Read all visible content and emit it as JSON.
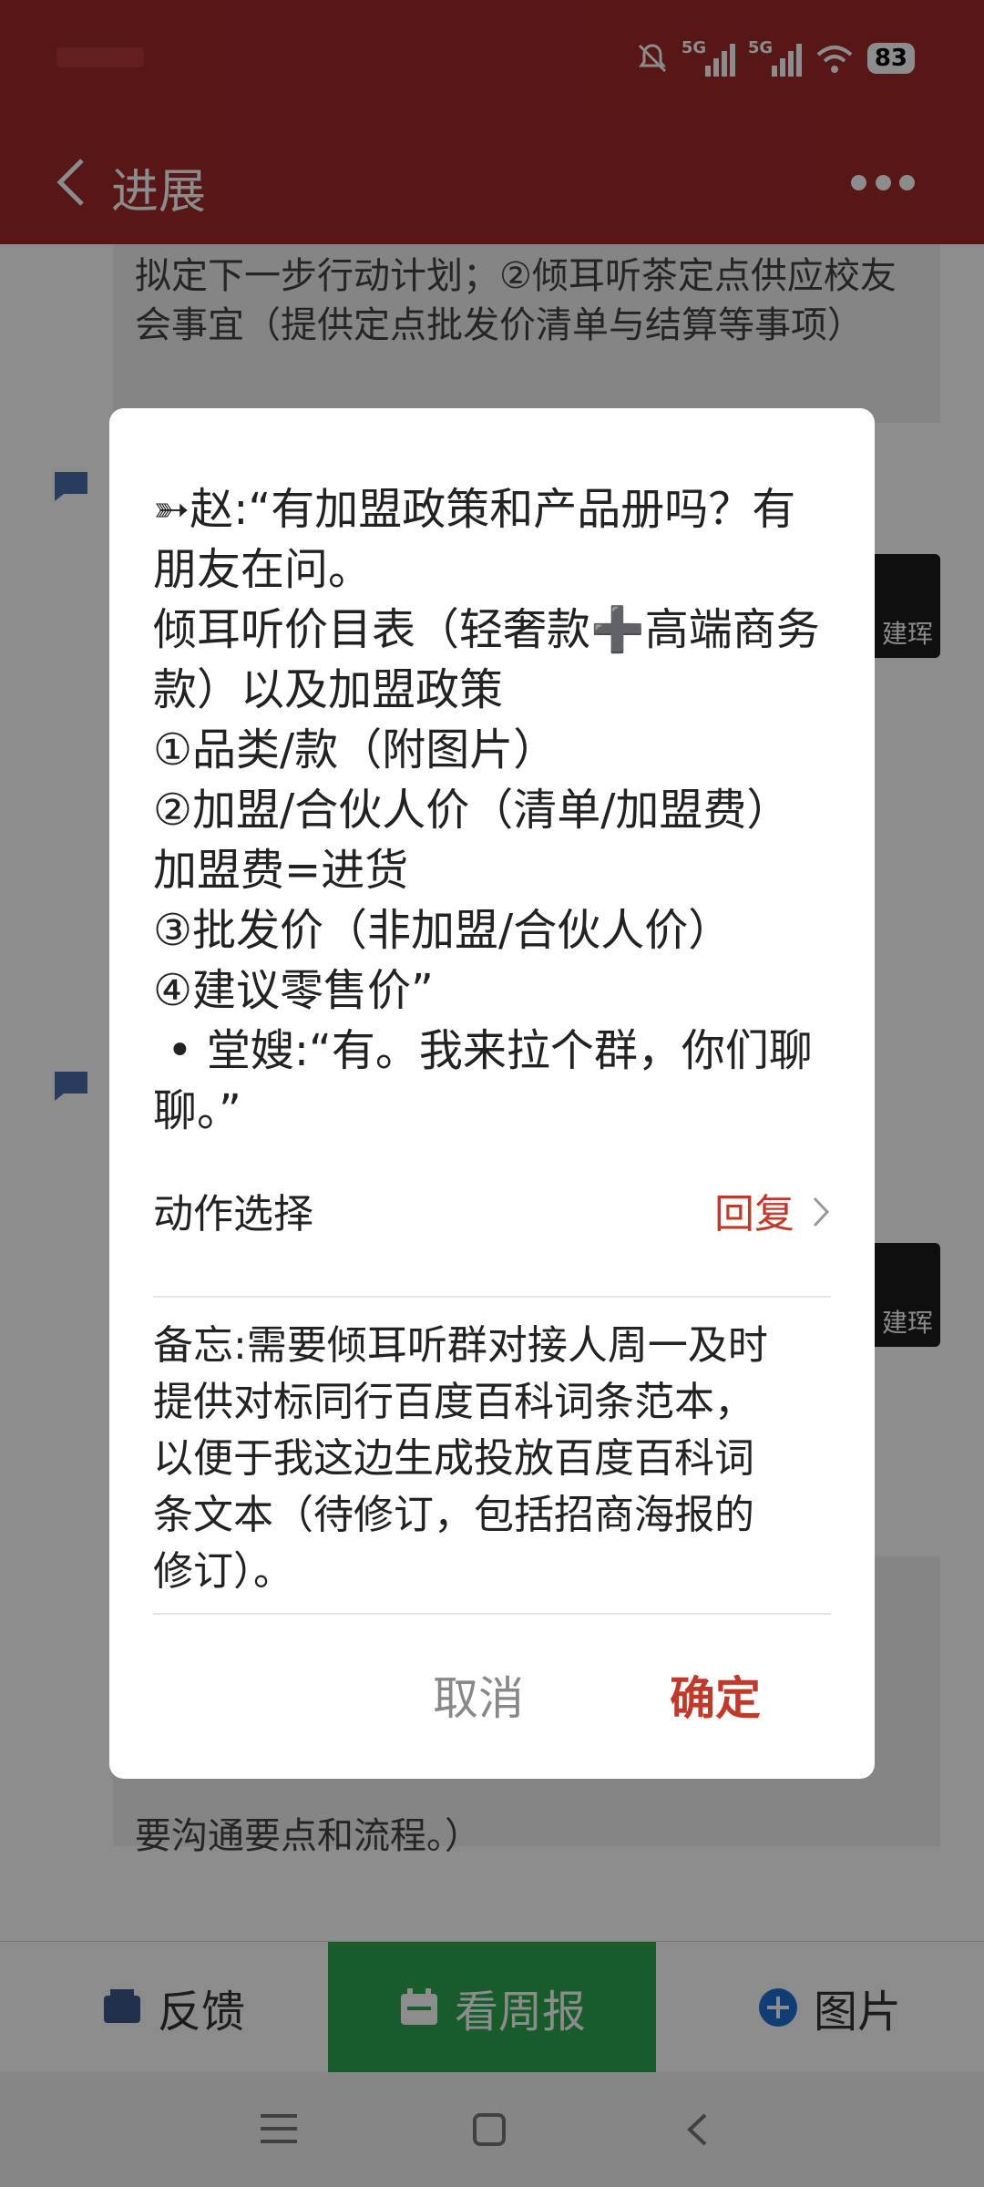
{
  "status_bar": {
    "battery": "83",
    "network_1": "5G",
    "network_2": "5G"
  },
  "nav": {
    "title": "进展"
  },
  "background": {
    "card_top_text": "拟定下一步行动计划；②倾耳听茶定点供应校友会事宜（提供定点批发价清单与结算等事项）",
    "card_bottom_text": "要沟通要点和流程。）",
    "thumb_label": "建珲",
    "bottom_nav": {
      "feedback": "反馈",
      "weekly": "看周报",
      "picture": "图片"
    }
  },
  "dialog": {
    "message": "➳赵:“有加盟政策和产品册吗？有朋友在问。\n倾耳听价目表（轻奢款➕高端商务款）以及加盟政策\n①品类/款（附图片）\n②加盟/合伙人价（清单/加盟费）加盟费=进货\n③批发价（非加盟/合伙人价）\n④建议零售价”\n • 堂嫂:“有。我来拉个群，你们聊聊。”",
    "action_label": "动作选择",
    "action_value": "回复",
    "memo": "备忘:需要倾耳听群对接人周一及时\n提供对标同行百度百科词条范本，\n以便于我这边生成投放百度百科词\n条文本（待修订，包括招商海报的\n修订）。",
    "cancel": "取消",
    "confirm": "确定"
  },
  "colors": {
    "header": "#9e2a2b",
    "accent": "#c0392b",
    "green": "#2fa84f"
  }
}
